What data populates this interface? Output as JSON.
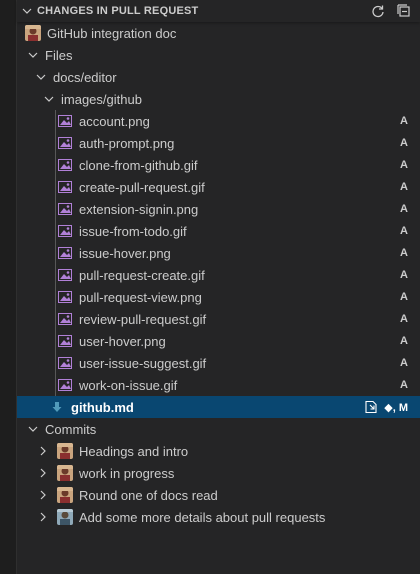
{
  "header": {
    "title": "CHANGES IN PULL REQUEST"
  },
  "pr": {
    "title": "GitHub integration doc"
  },
  "files": {
    "label": "Files",
    "folder": "docs/editor",
    "subfolder": "images/github",
    "images": [
      {
        "name": "account.png",
        "status": "A"
      },
      {
        "name": "auth-prompt.png",
        "status": "A"
      },
      {
        "name": "clone-from-github.gif",
        "status": "A"
      },
      {
        "name": "create-pull-request.gif",
        "status": "A"
      },
      {
        "name": "extension-signin.png",
        "status": "A"
      },
      {
        "name": "issue-from-todo.gif",
        "status": "A"
      },
      {
        "name": "issue-hover.png",
        "status": "A"
      },
      {
        "name": "pull-request-create.gif",
        "status": "A"
      },
      {
        "name": "pull-request-view.png",
        "status": "A"
      },
      {
        "name": "review-pull-request.gif",
        "status": "A"
      },
      {
        "name": "user-hover.png",
        "status": "A"
      },
      {
        "name": "user-issue-suggest.gif",
        "status": "A"
      },
      {
        "name": "work-on-issue.gif",
        "status": "A"
      }
    ],
    "selected_file": {
      "name": "github.md",
      "status": "◆, M"
    }
  },
  "commits": {
    "label": "Commits",
    "items": [
      {
        "message": "Headings and intro"
      },
      {
        "message": "work in progress"
      },
      {
        "message": "Round one of docs read"
      },
      {
        "message": "Add some more details about pull requests"
      }
    ]
  },
  "colors": {
    "background": "#252526",
    "selection": "#094771",
    "image_icon": "#b180d7",
    "markdown_icon": "#519aba"
  }
}
